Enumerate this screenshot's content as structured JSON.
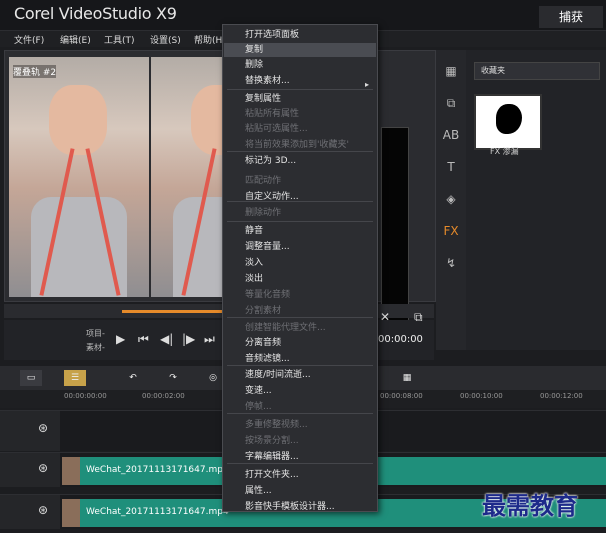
{
  "app": {
    "title": "Corel VideoStudio X9",
    "capture_tab": "捕获"
  },
  "menubar": [
    "文件(F)",
    "编辑(E)",
    "工具(T)",
    "设置(S)",
    "帮助(H)"
  ],
  "preview": {
    "track_tag": "覆叠轨 #2",
    "label_project": "项目-",
    "label_clip": "素材-",
    "timecode": "00:00:00"
  },
  "library": {
    "dropdown": "收藏夹",
    "thumb_label": "FX 渗漏"
  },
  "ruler": [
    "00:00:00:00",
    "00:00:02:00",
    "00:00:08:00",
    "00:00:10:00",
    "00:00:12:00"
  ],
  "tracks": [
    {
      "clip": "WeChat_20171113171647.mp4"
    },
    {
      "clip": "WeChat_20171113171647.mp4"
    }
  ],
  "context_menu": [
    {
      "label": "打开选项面板",
      "disabled": false
    },
    {
      "label": "复制",
      "disabled": false
    },
    {
      "label": "删除",
      "disabled": false
    },
    {
      "label": "替换素材...",
      "disabled": false,
      "submenu": true
    },
    {
      "label": "复制属性",
      "disabled": false
    },
    {
      "label": "粘贴所有属性",
      "disabled": true
    },
    {
      "label": "粘贴可选属性...",
      "disabled": true
    },
    {
      "label": "将当前效果添加到'收藏夹'",
      "disabled": true
    },
    {
      "label": "标记为 3D...",
      "disabled": false
    },
    {
      "label": "匹配动作",
      "disabled": true
    },
    {
      "label": "自定义动作...",
      "disabled": false
    },
    {
      "label": "删除动作",
      "disabled": true
    },
    {
      "label": "静音",
      "disabled": false
    },
    {
      "label": "调整音量...",
      "disabled": false
    },
    {
      "label": "淡入",
      "disabled": false
    },
    {
      "label": "淡出",
      "disabled": false
    },
    {
      "label": "等量化音频",
      "disabled": true
    },
    {
      "label": "分割素材",
      "disabled": true
    },
    {
      "label": "创建智能代理文件...",
      "disabled": true
    },
    {
      "label": "分离音频",
      "disabled": false
    },
    {
      "label": "音频滤镜...",
      "disabled": false
    },
    {
      "label": "速度/时间流逝...",
      "disabled": false
    },
    {
      "label": "变速...",
      "disabled": false
    },
    {
      "label": "停帧...",
      "disabled": true
    },
    {
      "label": "多重修整视频...",
      "disabled": true
    },
    {
      "label": "按场景分割...",
      "disabled": true
    },
    {
      "label": "字幕编辑器...",
      "disabled": false
    },
    {
      "label": "打开文件夹...",
      "disabled": false
    },
    {
      "label": "属性...",
      "disabled": false
    },
    {
      "label": "影音快手模板设计器...",
      "disabled": false
    }
  ],
  "watermark": "最需教育",
  "colors": {
    "accent": "#e58a2a",
    "clip": "#1f8f7b"
  }
}
